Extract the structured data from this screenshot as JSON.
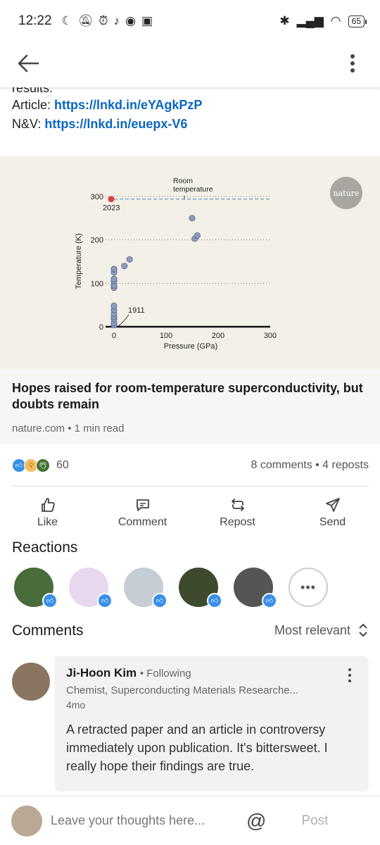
{
  "status": {
    "time": "12:22",
    "battery": "65"
  },
  "post": {
    "clipped_line": "results.",
    "article_label": "Article:",
    "article_link": "https://lnkd.in/eYAgkPzP",
    "nv_label": "N&V:",
    "nv_link": "https://lnkd.in/euepx-V6"
  },
  "card": {
    "badge": "nature",
    "title": "Hopes raised for room-temperature superconductivity, but doubts remain",
    "meta": "nature.com • 1 min read"
  },
  "chart_data": {
    "type": "scatter",
    "xlabel": "Pressure (GPa)",
    "ylabel": "Temperature (K)",
    "xlim": [
      0,
      300
    ],
    "ylim": [
      0,
      300
    ],
    "xticks": [
      "0",
      "100",
      "200",
      "300"
    ],
    "yticks": [
      "0",
      "100",
      "200",
      "300"
    ],
    "reference_line": {
      "label": "Room temperature",
      "y": 294
    },
    "annotations": [
      {
        "label": "2023",
        "x": 0,
        "y": 294
      },
      {
        "label": "1911",
        "x": 0,
        "y": 4
      }
    ],
    "points": [
      {
        "x": 0,
        "y": 4
      },
      {
        "x": 0,
        "y": 9
      },
      {
        "x": 0,
        "y": 18
      },
      {
        "x": 0,
        "y": 23
      },
      {
        "x": 0,
        "y": 30
      },
      {
        "x": 0,
        "y": 39
      },
      {
        "x": 0,
        "y": 48
      },
      {
        "x": 0,
        "y": 90
      },
      {
        "x": 0,
        "y": 95
      },
      {
        "x": 0,
        "y": 105
      },
      {
        "x": 0,
        "y": 110
      },
      {
        "x": 0,
        "y": 125
      },
      {
        "x": 0,
        "y": 133
      },
      {
        "x": 20,
        "y": 140
      },
      {
        "x": 30,
        "y": 155
      },
      {
        "x": 150,
        "y": 250
      },
      {
        "x": 155,
        "y": 203
      },
      {
        "x": 160,
        "y": 210
      }
    ],
    "highlight_point": {
      "x": 0,
      "y": 294,
      "color": "#d94040"
    }
  },
  "social": {
    "reaction_count": "60",
    "comments_reposts": "8 comments • 4 reposts"
  },
  "actions": {
    "like": "Like",
    "comment": "Comment",
    "repost": "Repost",
    "send": "Send"
  },
  "reactions_section": {
    "title": "Reactions"
  },
  "comments_section": {
    "title": "Comments",
    "sort": "Most relevant"
  },
  "comment": {
    "name": "Ji-Hoon Kim",
    "relation": "• Following",
    "headline": "Chemist, Superconducting Materials Researche...",
    "time": "4mo",
    "body": "A retracted paper and an article in controversy immediately upon publication. It's bittersweet. I really hope their findings are true."
  },
  "composer": {
    "placeholder": "Leave your thoughts here...",
    "post": "Post"
  },
  "colors": {
    "link": "#0a66c2",
    "like_blue": "#378fe9",
    "card_bg": "#f3f0e7"
  }
}
